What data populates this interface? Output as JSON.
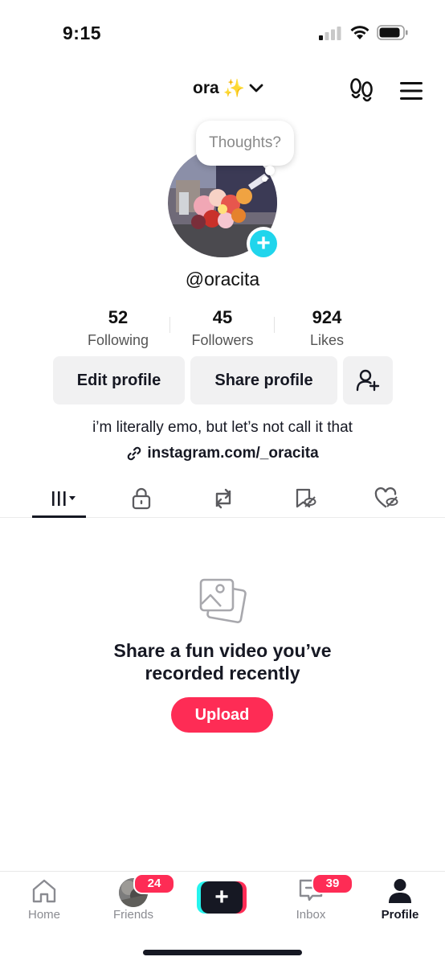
{
  "status_bar": {
    "time": "9:15"
  },
  "header": {
    "username": "ora",
    "username_emoji": "✨"
  },
  "thought_bubble": {
    "placeholder": "Thoughts?"
  },
  "profile": {
    "handle": "@oracita",
    "stats": [
      {
        "value": "52",
        "label": "Following"
      },
      {
        "value": "45",
        "label": "Followers"
      },
      {
        "value": "924",
        "label": "Likes"
      }
    ],
    "buttons": {
      "edit": "Edit profile",
      "share": "Share profile"
    },
    "bio": "i’m literally emo, but let’s not call it that",
    "link": "instagram.com/_oracita"
  },
  "tabs": [
    {
      "icon": "grid-icon",
      "active": true
    },
    {
      "icon": "lock-icon"
    },
    {
      "icon": "repost-icon"
    },
    {
      "icon": "bookmark-hidden-icon"
    },
    {
      "icon": "heart-hidden-icon"
    }
  ],
  "empty_state": {
    "title_line1": "Share a fun video you’ve",
    "title_line2": "recorded recently",
    "button": "Upload"
  },
  "bottom_nav": {
    "home": {
      "label": "Home"
    },
    "friends": {
      "label": "Friends",
      "badge": "24"
    },
    "inbox": {
      "label": "Inbox",
      "badge": "39"
    },
    "profile": {
      "label": "Profile"
    }
  },
  "colors": {
    "accent": "#fe2c55",
    "teal": "#20d5ec",
    "text": "#161823",
    "button_bg": "#f1f1f2"
  }
}
